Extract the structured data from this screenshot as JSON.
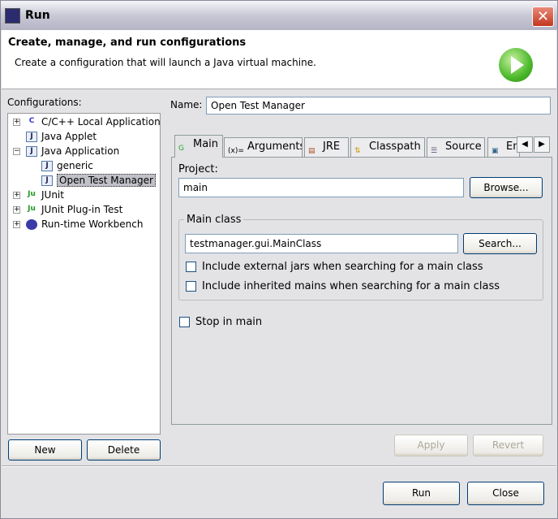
{
  "window": {
    "title": "Run",
    "close": "✕"
  },
  "header": {
    "title": "Create, manage, and run configurations",
    "description": "Create a configuration that will launch a Java virtual machine."
  },
  "configurations": {
    "label": "Configurations:",
    "items": [
      {
        "label": "C/C++ Local Application",
        "icon": "cpp-icon",
        "expander": "+"
      },
      {
        "label": "Java Applet",
        "icon": "java-applet-icon"
      },
      {
        "label": "Java Application",
        "icon": "java-app-icon",
        "expander": "−"
      },
      {
        "label": "generic",
        "icon": "java-app-icon"
      },
      {
        "label": "Open Test Manager",
        "icon": "java-app-icon",
        "selected": true
      },
      {
        "label": "JUnit",
        "icon": "junit-icon",
        "expander": "+"
      },
      {
        "label": "JUnit Plug-in Test",
        "icon": "junit-plugin-icon",
        "expander": "+"
      },
      {
        "label": "Run-time Workbench",
        "icon": "workbench-icon",
        "expander": "+"
      }
    ],
    "new": "New",
    "delete": "Delete"
  },
  "name": {
    "label": "Name:",
    "value": "Open Test Manager"
  },
  "tabs": [
    {
      "label": "Main",
      "icon": "G"
    },
    {
      "label": "Arguments",
      "icon": "(x)="
    },
    {
      "label": "JRE",
      "icon": "▤"
    },
    {
      "label": "Classpath",
      "icon": "⇅"
    },
    {
      "label": "Source",
      "icon": "☰"
    },
    {
      "label": "En",
      "icon": "▣"
    }
  ],
  "main": {
    "project_label": "Project:",
    "project": "main",
    "browse": "Browse...",
    "main_class_label": "Main class",
    "main_class": "testmanager.gui.MainClass",
    "search": "Search...",
    "include_external": "Include external jars when searching for a main class",
    "include_inherited": "Include inherited mains when searching for a main class",
    "stop_in_main": "Stop in main"
  },
  "buttons": {
    "apply": "Apply",
    "revert": "Revert",
    "run": "Run",
    "close": "Close"
  }
}
